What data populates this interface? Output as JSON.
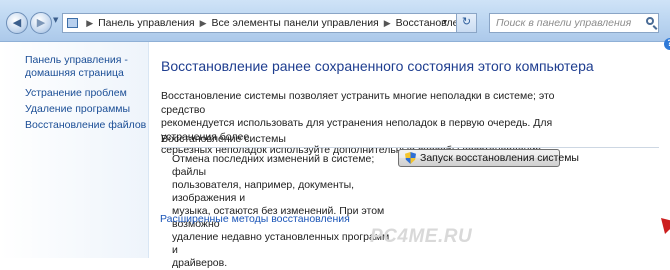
{
  "address_bar": {
    "breadcrumbs": [
      "Панель управления",
      "Все элементы панели управления",
      "Восстановление"
    ]
  },
  "search": {
    "placeholder": "Поиск в панели управления"
  },
  "sidebar": {
    "home_line1": "Панель управления -",
    "home_line2": "домашняя страница",
    "links": [
      "Устранение проблем",
      "Удаление программы",
      "Восстановление файлов"
    ]
  },
  "main": {
    "title": "Восстановление ранее сохраненного состояния этого компьютера",
    "intro_lines": [
      "Восстановление системы позволяет устранить многие неполадки в системе; это средство",
      "рекомендуется использовать для устранения неполадок в первую очередь. Для устранения более",
      "серьезных неполадок используйте дополнительные способы восстановления."
    ],
    "section_title": "Восстановление системы",
    "desc_lines": [
      "Отмена последних изменений в системе; файлы",
      "пользователя, например, документы, изображения и",
      "музыка, остаются без изменений. При этом возможно",
      "удаление недавно установленных программ и",
      "драйверов."
    ],
    "restore_button": "Запуск восстановления системы",
    "advanced_link": "Расширенные методы восстановления"
  },
  "watermark": "PC4ME.RU",
  "colors": {
    "link": "#1a55b8",
    "title": "#1e3d8f",
    "arrow": "#cc1e1e",
    "nav_gradient_top": "#cfe3f7"
  },
  "icons": [
    "back-arrow-icon",
    "forward-arrow-icon",
    "control-panel-icon",
    "refresh-icon",
    "search-icon",
    "help-icon",
    "uac-shield-icon",
    "red-arrow-annotation"
  ]
}
